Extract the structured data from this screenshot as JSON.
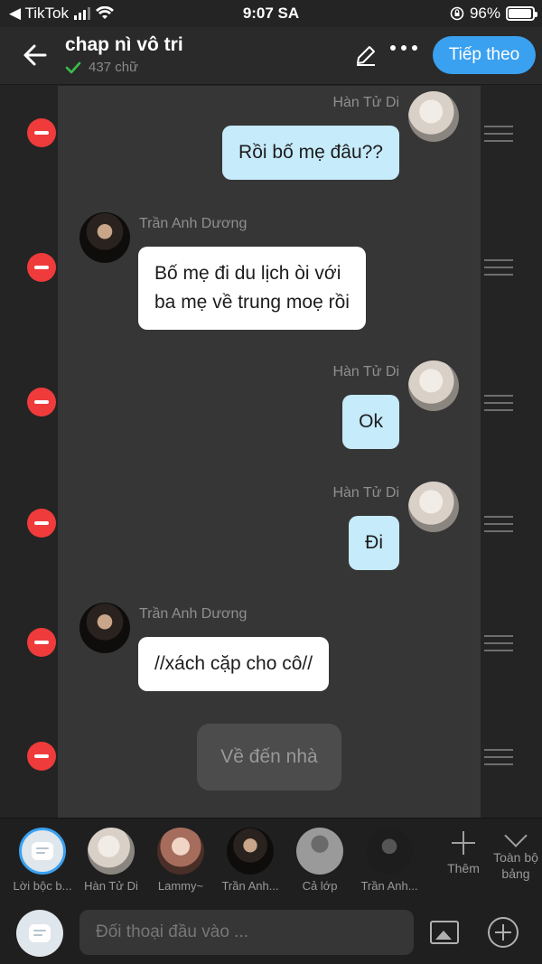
{
  "status_bar": {
    "back_app": "◀ TikTok",
    "time": "9:07 SA",
    "battery": "96%",
    "battery_level": 0.96
  },
  "header": {
    "title": "chap nì vô tri",
    "word_count": "437 chữ",
    "next_label": "Tiếp theo"
  },
  "messages": [
    {
      "speaker": "Hàn Tử Di",
      "text": "Rồi bố mẹ đâu??",
      "side": "right"
    },
    {
      "speaker": "Trần Anh Dương",
      "text_lines": [
        "Bố mẹ đi du lịch òi với",
        "ba mẹ về trung moẹ rồi"
      ],
      "side": "left"
    },
    {
      "speaker": "Hàn Tử Di",
      "text": "Ok",
      "side": "right"
    },
    {
      "speaker": "Hàn Tử Di",
      "text": "Đi",
      "side": "right"
    },
    {
      "speaker": "Trần Anh Dương",
      "text": "//xách cặp cho cô//",
      "side": "left"
    },
    {
      "type": "narration",
      "text": "Về đến nhà"
    }
  ],
  "characters": [
    {
      "label": "Lời bộc b..."
    },
    {
      "label": "Hàn Tử Di"
    },
    {
      "label": "Lammy~"
    },
    {
      "label": "Trần Anh..."
    },
    {
      "label": "Cả lớp"
    },
    {
      "label": "Trần Anh..."
    }
  ],
  "strip_actions": {
    "more": "Thêm",
    "all": "Toàn bộ bảng"
  },
  "input": {
    "placeholder": "Đối thoại đầu vào ..."
  },
  "colors": {
    "accent": "#3aa1f0",
    "delete": "#ef3b3b",
    "outgoing_bubble": "#c6ebfb"
  }
}
